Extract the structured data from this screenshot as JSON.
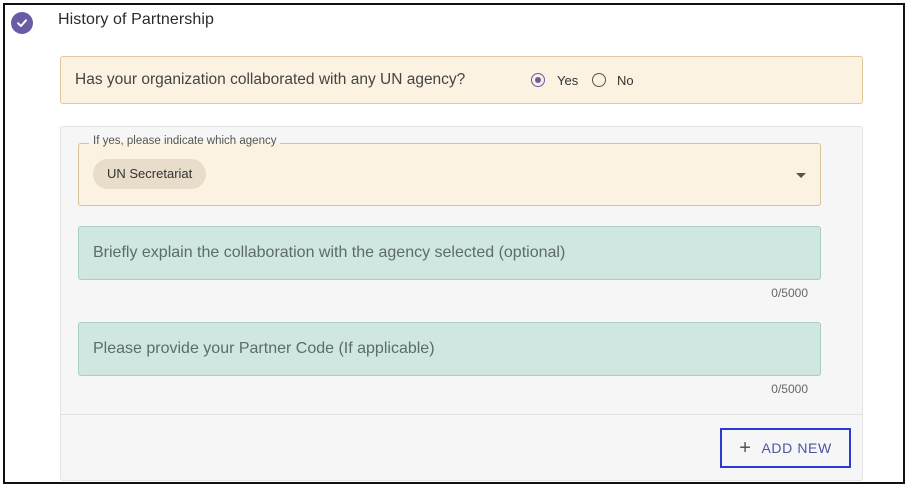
{
  "section": {
    "title": "History of Partnership",
    "status_icon": "check-circle-icon"
  },
  "question": {
    "text": "Has your organization collaborated with any UN agency?",
    "options": [
      {
        "label": "Yes",
        "selected": true
      },
      {
        "label": "No",
        "selected": false
      }
    ]
  },
  "agency_select": {
    "legend": "If yes, please indicate which agency",
    "selected_chip": "UN Secretariat"
  },
  "collaboration_field": {
    "placeholder": "Briefly explain the collaboration with the agency selected (optional)",
    "counter": "0/5000"
  },
  "partner_code_field": {
    "placeholder": "Please provide your Partner Code (If applicable)",
    "counter": "0/5000"
  },
  "actions": {
    "add_new_label": "ADD NEW",
    "add_icon": "plus-icon"
  },
  "colors": {
    "accent": "#6a5ba6",
    "question_bg": "#fcf2e1",
    "field_bg": "#cfe6e1",
    "highlight_border": "#2a3bd4"
  }
}
